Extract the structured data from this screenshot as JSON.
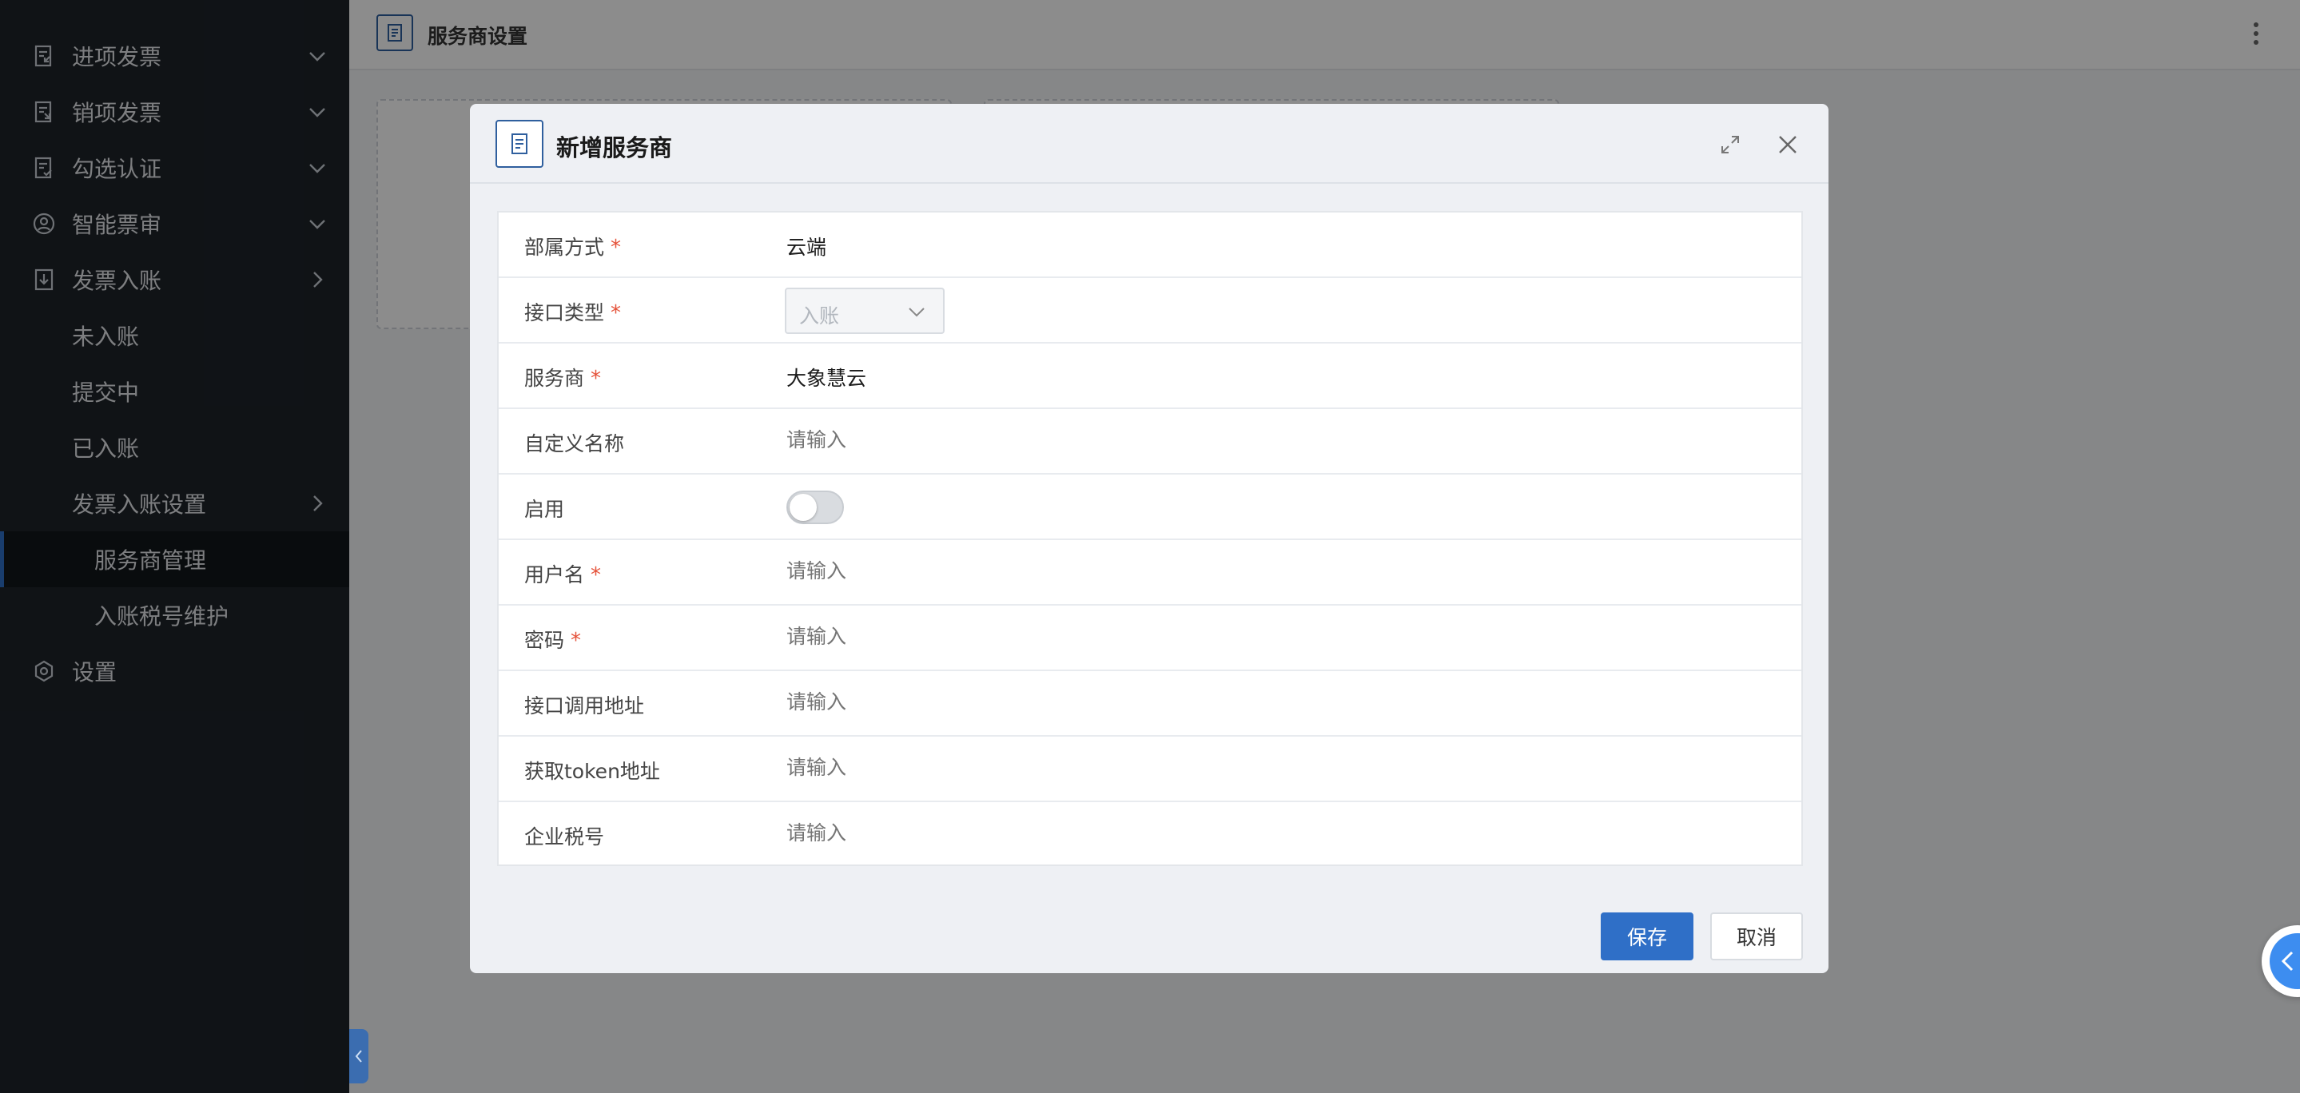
{
  "sidebar": {
    "items": [
      {
        "label": "进项发票",
        "icon": "invoice-in-icon"
      },
      {
        "label": "销项发票",
        "icon": "invoice-out-icon"
      },
      {
        "label": "勾选认证",
        "icon": "check-cert-icon"
      },
      {
        "label": "智能票审",
        "icon": "smart-review-icon"
      },
      {
        "label": "发票入账",
        "icon": "ledger-in-icon"
      },
      {
        "label": "未入账"
      },
      {
        "label": "提交中"
      },
      {
        "label": "已入账"
      },
      {
        "label": "发票入账设置"
      },
      {
        "label": "服务商管理"
      },
      {
        "label": "入账税号维护"
      },
      {
        "label": "设置",
        "icon": "settings-icon"
      }
    ]
  },
  "topbar": {
    "title": "服务商设置"
  },
  "modal": {
    "title": "新增服务商",
    "fields": [
      {
        "label": "部属方式",
        "required": "*",
        "value": "云端"
      },
      {
        "label": "接口类型",
        "required": "*",
        "select_value": "入账"
      },
      {
        "label": "服务商",
        "required": "*",
        "value": "大象慧云"
      },
      {
        "label": "自定义名称",
        "placeholder": "请输入"
      },
      {
        "label": "启用",
        "toggle_on": false
      },
      {
        "label": "用户名",
        "required": "*",
        "placeholder": "请输入"
      },
      {
        "label": "密码",
        "required": "*",
        "placeholder": "请输入"
      },
      {
        "label": "接口调用地址",
        "placeholder": "请输入"
      },
      {
        "label": "获取token地址",
        "placeholder": "请输入"
      },
      {
        "label": "企业税号",
        "placeholder": "请输入"
      }
    ],
    "save_label": "保存",
    "cancel_label": "取消"
  },
  "colors": {
    "accent": "#2f6fc7",
    "sidebar_bg": "#1e2329",
    "required": "#e5533b"
  }
}
